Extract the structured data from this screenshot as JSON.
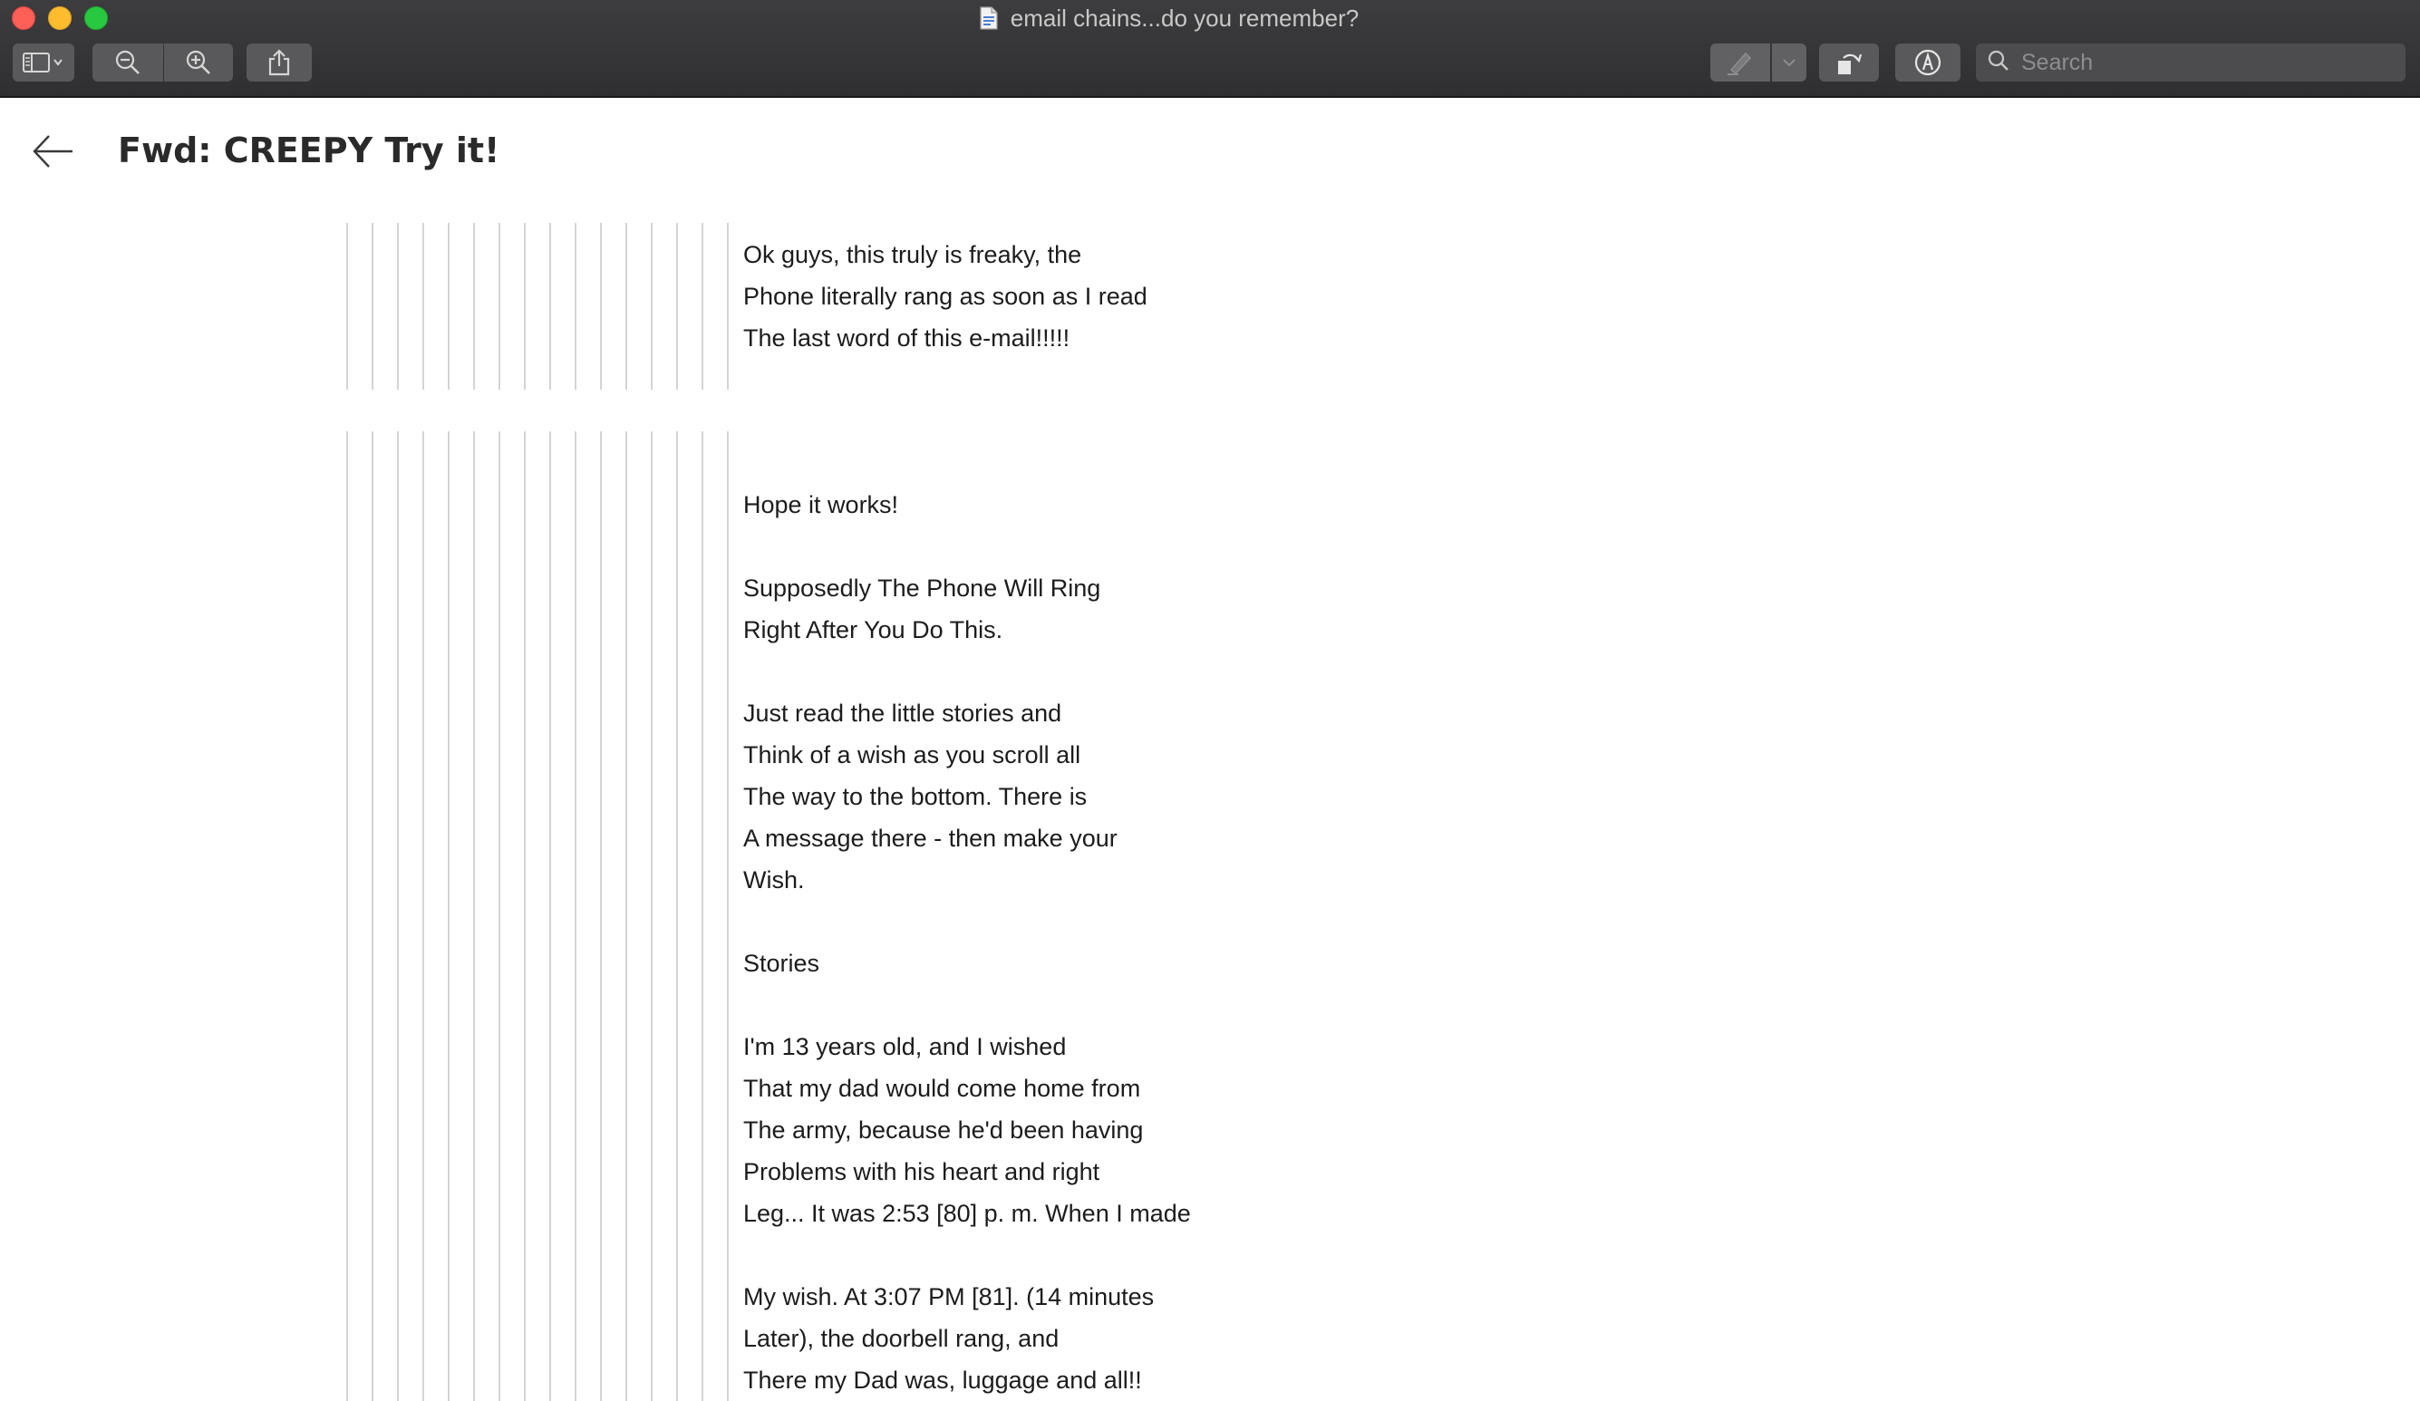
{
  "window": {
    "title": "email chains...do you remember?"
  },
  "toolbar": {
    "search_placeholder": "Search"
  },
  "email": {
    "subject": "Fwd: CREEPY Try it!",
    "block1": [
      "Ok guys, this truly is freaky, the",
      "Phone literally rang as soon as I read",
      "The last word of this e-mail!!!!!"
    ],
    "block2": [
      "",
      "Hope it works!",
      "",
      "Supposedly The Phone Will Ring",
      "Right After You Do This.",
      "",
      "Just read the little stories and",
      "Think of a wish as you scroll all",
      "The way to the bottom. There is",
      "A message there - then make your",
      "Wish.",
      "",
      "Stories",
      "",
      "I'm 13 years old, and I wished",
      "That my dad would come home from",
      "The army, because he'd been having",
      "Problems with his heart and right",
      "Leg... It was 2:53 [80] p. m. When I made",
      "",
      "My wish. At 3:07 PM [81]. (14 minutes",
      "Later), the doorbell rang, and",
      "There my Dad was, luggage and all!!"
    ]
  },
  "colors": {
    "titlebar": "#38383a",
    "toolbar_button": "#59595b",
    "quote_line": "#d4d4d4",
    "text": "#1c1c1c"
  },
  "icons": {
    "sidebar": "sidebar-icon",
    "zoom_out": "zoom-out-icon",
    "zoom_in": "zoom-in-icon",
    "share": "share-icon",
    "highlight": "highlighter-icon",
    "rotate": "rotate-icon",
    "markup": "markup-icon",
    "search": "search-icon",
    "back": "back-arrow-icon"
  }
}
